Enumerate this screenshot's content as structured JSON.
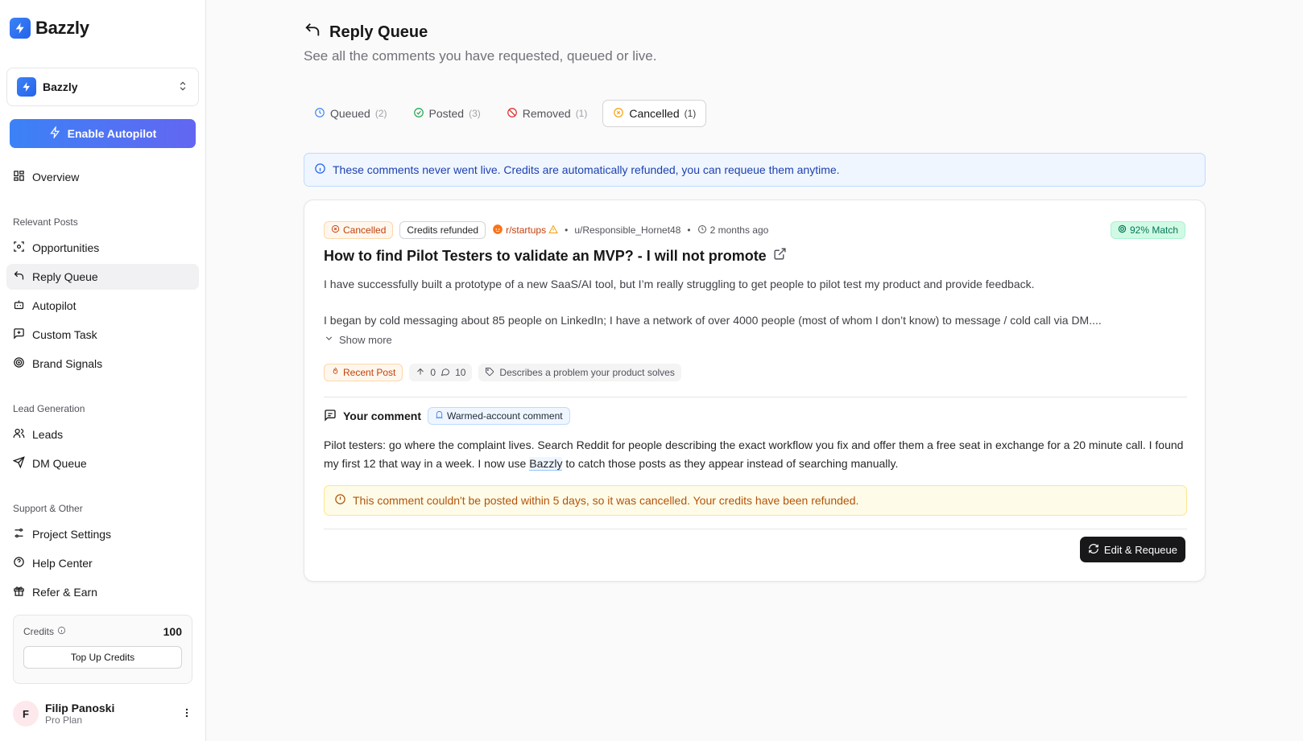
{
  "brand": {
    "name": "Bazzly"
  },
  "project": {
    "name": "Bazzly"
  },
  "sidebar": {
    "autopilot_button": "Enable Autopilot",
    "overview": "Overview",
    "section_relevant": "Relevant Posts",
    "relevant_items": [
      "Opportunities",
      "Reply Queue",
      "Autopilot",
      "Custom Task",
      "Brand Signals"
    ],
    "section_lead": "Lead Generation",
    "lead_items": [
      "Leads",
      "DM Queue"
    ],
    "section_support": "Support & Other",
    "support_items": [
      "Project Settings",
      "Help Center",
      "Refer & Earn"
    ],
    "credits": {
      "label": "Credits",
      "value": "100",
      "topup": "Top Up Credits"
    },
    "user": {
      "initial": "F",
      "name": "Filip Panoski",
      "plan": "Pro Plan"
    }
  },
  "page": {
    "title": "Reply Queue",
    "subtitle": "See all the comments you have requested, queued or live."
  },
  "tabs": [
    {
      "label": "Queued",
      "count": "(2)"
    },
    {
      "label": "Posted",
      "count": "(3)"
    },
    {
      "label": "Removed",
      "count": "(1)"
    },
    {
      "label": "Cancelled",
      "count": "(1)"
    }
  ],
  "info_banner": "These comments never went live. Credits are automatically refunded, you can requeue them anytime.",
  "card": {
    "status": "Cancelled",
    "refund": "Credits refunded",
    "subreddit": "r/startups",
    "sep1": "•",
    "author": "u/Responsible_Hornet48",
    "sep2": "•",
    "time": "2 months ago",
    "match": "92% Match",
    "title": "How to find Pilot Testers to validate an MVP? - I will not promote",
    "body_p1": "I have successfully built a prototype of a new SaaS/AI tool, but I’m really struggling to get people to pilot test my product and provide feedback.",
    "body_p2": "I began by cold messaging about 85 people on LinkedIn; I have a network of over 4000 people (most of whom I don’t know) to message / cold call via DM....",
    "show_more": "Show more",
    "recent": "Recent Post",
    "upvotes": "0",
    "comments": "10",
    "tag": "Describes a problem your product solves",
    "comment_label": "Your comment",
    "comment_badge": "Warmed-account comment",
    "comment_before": "Pilot testers: go where the complaint lives. Search Reddit for people describing the exact workflow you fix and offer them a free seat in exchange for a 20 minute call. I found my first 12 that way in a week. I now use ",
    "comment_highlight": "Bazzly",
    "comment_after": " to catch those posts as they appear instead of searching manually.",
    "warning": "This comment couldn't be posted within 5 days, so it was cancelled. Your credits have been refunded.",
    "requeue_button": "Edit & Requeue"
  }
}
